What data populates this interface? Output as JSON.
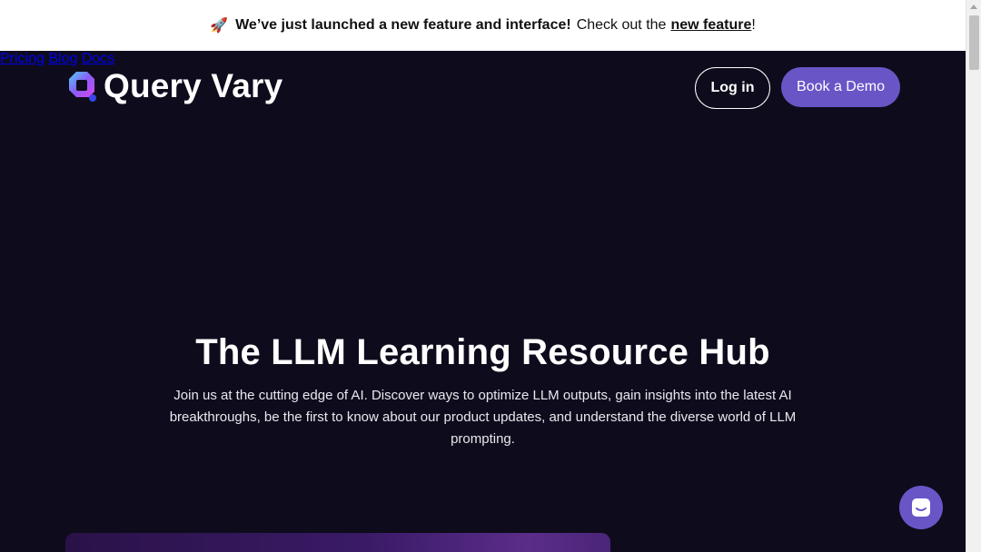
{
  "banner": {
    "emoji": "🚀",
    "headline": "We’ve just launched a new feature and interface!",
    "cta_prefix": "Check out the",
    "cta_link": "new feature",
    "cta_suffix": "!"
  },
  "header": {
    "brand": "Query Vary",
    "nav": [
      "Pricing",
      "Blog",
      "Docs"
    ],
    "login_label": "Log in",
    "demo_label": "Book a Demo"
  },
  "hero": {
    "title": "The LLM Learning Resource Hub",
    "description": "Join us at the cutting edge of AI. Discover ways to optimize LLM outputs, gain insights into the latest AI breakthroughs, be the first to know about our product updates, and understand the diverse world of LLM prompting."
  },
  "colors": {
    "background": "#0e0c1c",
    "accent": "#6a55c7",
    "banner_bg": "#ffffff"
  },
  "icons": {
    "logo": "query-vary-logo-icon",
    "chat": "chat-bubble-icon",
    "rocket": "rocket-icon"
  }
}
